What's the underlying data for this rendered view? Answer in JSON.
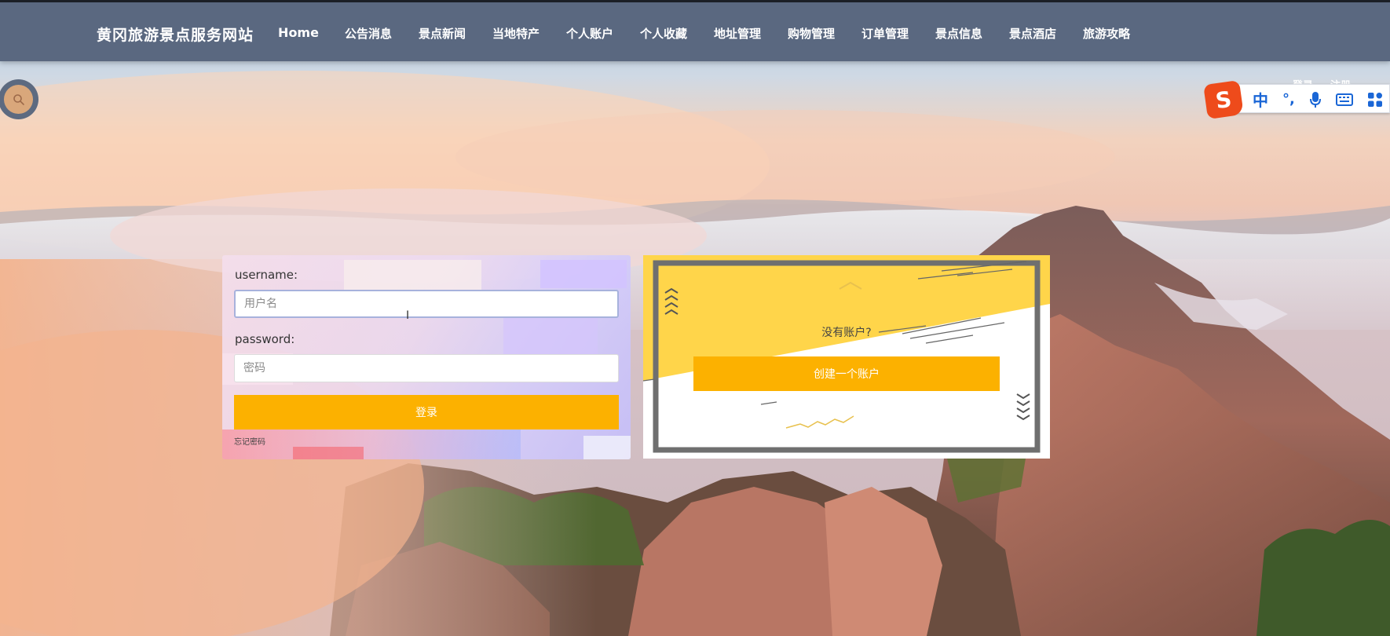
{
  "site": {
    "title": "黄冈旅游景点服务网站"
  },
  "nav": {
    "items": [
      "Home",
      "公告消息",
      "景点新闻",
      "当地特产",
      "个人账户",
      "个人收藏",
      "地址管理",
      "购物管理",
      "订单管理",
      "景点信息",
      "景点酒店",
      "旅游攻略"
    ]
  },
  "auth_links": {
    "login": "登录",
    "register": "注册"
  },
  "ime": {
    "logo": "S",
    "mode": "中",
    "punctuation": "°,"
  },
  "login_form": {
    "username_label": "username:",
    "username_placeholder": "用户名",
    "password_label": "password:",
    "password_placeholder": "密码",
    "submit_label": "登录",
    "forgot_label": "忘记密码"
  },
  "register_panel": {
    "prompt": "没有账户?",
    "create_label": "创建一个账户"
  },
  "colors": {
    "nav_bg": "#5a6880",
    "accent": "#fcb100",
    "panel_yellow": "#ffd54a"
  },
  "icons": {
    "search": "search-icon",
    "mic": "microphone-icon",
    "keyboard": "keyboard-icon",
    "grid": "grid-icon"
  }
}
